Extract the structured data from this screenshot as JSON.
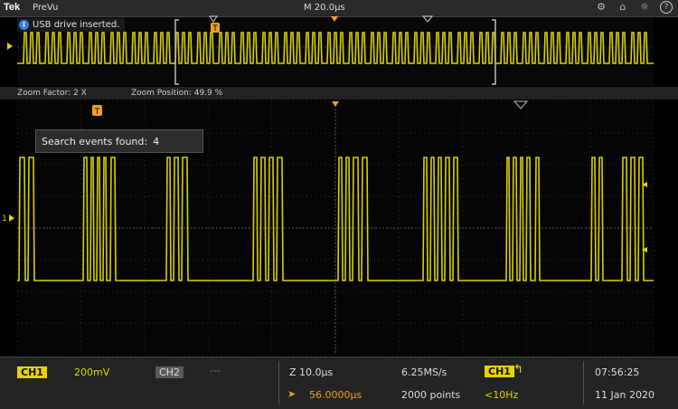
{
  "top_bar": {
    "brand": "Tek",
    "mode": "PreVu",
    "timebase": "M 20.0µs"
  },
  "notification": {
    "text": "USB drive inserted."
  },
  "overview": {
    "trigger_marker": "T"
  },
  "zoom_info": {
    "factor": "Zoom Factor: 2 X",
    "position": "Zoom Position: 49.9 %"
  },
  "main": {
    "trigger_marker": "T",
    "channel_marker": "1"
  },
  "search_popup": {
    "label": "Search events found:",
    "count": "4"
  },
  "bottom_bar": {
    "ch1_label": "CH1",
    "ch1_scale": "200mV",
    "ch2_label": "CH2",
    "ch2_scale": "---",
    "zoom_scale": "Z 10.0µs",
    "delay": "56.0000µs",
    "sample_rate": "6.25MS/s",
    "record_length": "2000 points",
    "trigger_source": "CH1",
    "trigger_freq": "<10Hz",
    "time": "07:56:25",
    "date": "11 Jan 2020"
  },
  "colors": {
    "trace": "#d8d000",
    "accent": "#f0a020",
    "ch1": "#e8d400"
  },
  "icons": [
    "lock-icon",
    "home-icon",
    "brightness-icon",
    "help-icon"
  ]
}
